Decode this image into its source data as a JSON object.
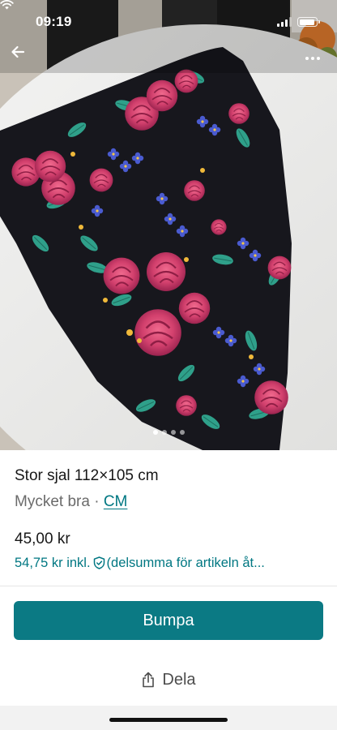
{
  "status_bar": {
    "time": "09:19",
    "battery_level": 0.9
  },
  "photo": {
    "description_icons": {
      "back": "arrow-left-icon",
      "more": "more-horizontal-icon"
    },
    "carousel": {
      "count": 4,
      "active_index": 0
    }
  },
  "item": {
    "title": "Stor sjal 112×105 cm",
    "condition": "Mycket bra",
    "separator": "·",
    "brand": "CM",
    "price": "45,00 kr",
    "price_incl": "54,75 kr inkl.",
    "price_incl_note": "(delsumma för artikeln åt..."
  },
  "actions": {
    "bump_label": "Bumpa",
    "share_label": "Dela"
  },
  "colors": {
    "accent": "#007782",
    "button": "#0b7a84"
  }
}
